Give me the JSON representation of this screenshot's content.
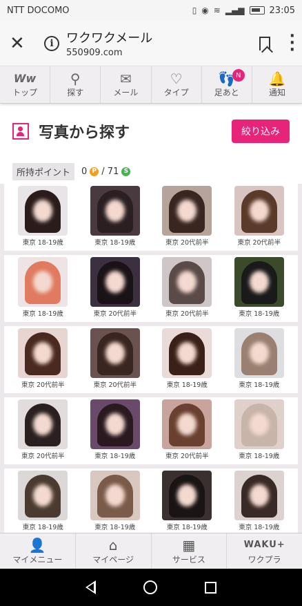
{
  "status": {
    "carrier": "NTT DOCOMO",
    "time": "23:05"
  },
  "browser": {
    "title": "ワクワクメール",
    "url": "550909.com"
  },
  "topnav": [
    {
      "label": "トップ",
      "icon": "ww-logo-icon",
      "glyph": "Ww"
    },
    {
      "label": "探す",
      "icon": "search-icon",
      "glyph": "⚲"
    },
    {
      "label": "メール",
      "icon": "mail-icon",
      "glyph": "✉"
    },
    {
      "label": "タイプ",
      "icon": "heart-icon",
      "glyph": "♡"
    },
    {
      "label": "足あと",
      "icon": "footprint-icon",
      "glyph": "👣",
      "badge": "N"
    },
    {
      "label": "通知",
      "icon": "bell-icon",
      "glyph": "🔔"
    }
  ],
  "header": {
    "title": "写真から探す",
    "filter_label": "絞り込み"
  },
  "points": {
    "label": "所持ポイント",
    "p_value": "0",
    "s_value": "/ 71",
    "p_coin": "P",
    "s_coin": "S"
  },
  "grid": [
    [
      {
        "caption": "東京 18-19歳",
        "bg": "#e9e4e8",
        "hair": "#2a1c1a"
      },
      {
        "caption": "東京 18-19歳",
        "bg": "#4a3a40",
        "hair": "#2b1f22"
      },
      {
        "caption": "東京 20代前半",
        "bg": "#b6a39a",
        "hair": "#3a2620"
      },
      {
        "caption": "東京 20代前半",
        "bg": "#d8c4c0",
        "hair": "#5a3a2a"
      }
    ],
    [
      {
        "caption": "東京 18-19歳",
        "bg": "#eee4e6",
        "hair": "#e07a60"
      },
      {
        "caption": "東京 20代前半",
        "bg": "#3a3040",
        "hair": "#1a1216"
      },
      {
        "caption": "東京 20代前半",
        "bg": "#cfc6c8",
        "hair": "#5a4a48"
      },
      {
        "caption": "東京 18-19歳",
        "bg": "#3a4a2a",
        "hair": "#1a1a1a"
      }
    ],
    [
      {
        "caption": "東京 20代前半",
        "bg": "#e8d4d0",
        "hair": "#4a2a20"
      },
      {
        "caption": "東京 20代前半",
        "bg": "#6a5250",
        "hair": "#3a2620"
      },
      {
        "caption": "東京 18-19歳",
        "bg": "#eadbd8",
        "hair": "#3a2018"
      },
      {
        "caption": "東京 18-19歳",
        "bg": "#dedee0",
        "hair": "#9a8070"
      }
    ],
    [
      {
        "caption": "東京 20代前半",
        "bg": "#e2dcdc",
        "hair": "#2a2020"
      },
      {
        "caption": "東京 18-19歳",
        "bg": "#6a4a6a",
        "hair": "#2a1a20"
      },
      {
        "caption": "東京 20代前半",
        "bg": "#c8a49c",
        "hair": "#6a4030"
      },
      {
        "caption": "東京 18-19歳",
        "bg": "#e0d0cc",
        "hair": "#c8b4a8"
      }
    ],
    [
      {
        "caption": "東京 18-19歳",
        "bg": "#ddd8d8",
        "hair": "#4a3a30"
      },
      {
        "caption": "東京 18-19歳",
        "bg": "#d8c8c0",
        "hair": "#7a5a48"
      },
      {
        "caption": "東京 18-19歳",
        "bg": "#3a3030",
        "hair": "#1a1414"
      },
      {
        "caption": "東京 18-19歳",
        "bg": "#dcd2d0",
        "hair": "#3a2a26"
      }
    ]
  ],
  "bottomnav": [
    {
      "label": "マイメニュー",
      "icon": "user-square-icon",
      "glyph": "👤"
    },
    {
      "label": "マイページ",
      "icon": "home-icon",
      "glyph": "⌂"
    },
    {
      "label": "サービス",
      "icon": "grid-icon",
      "glyph": "▦"
    },
    {
      "label": "ワクプラ",
      "icon": "wakuplus-logo-icon",
      "glyph": "WAKU+"
    }
  ],
  "colors": {
    "accent": "#e8247a"
  }
}
